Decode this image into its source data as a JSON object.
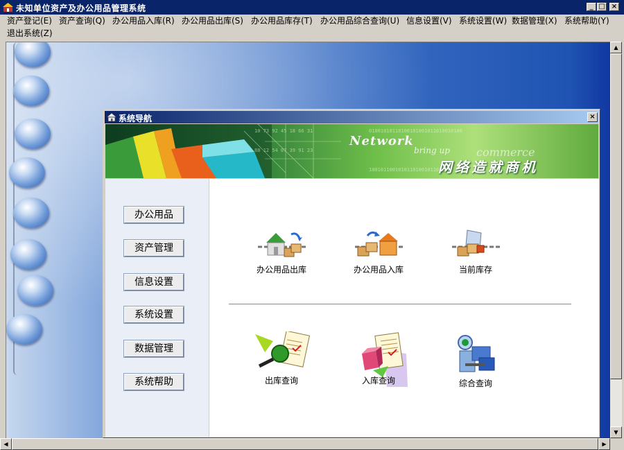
{
  "window": {
    "title": "未知单位资产及办公用品管理系统"
  },
  "menu": [
    "资产登记(E)",
    "资产查询(Q)",
    "办公用品入库(R)",
    "办公用品出库(S)",
    "办公用品库存(T)",
    "办公用品综合查询(U)",
    "信息设置(V)",
    "系统设置(W)",
    "数据管理(X)",
    "系统帮助(Y)",
    "退出系统(Z)"
  ],
  "nav": {
    "title": "系统导航",
    "banner": {
      "english": "Network",
      "english_sub": "bring up",
      "english_sub2": "commerce",
      "chinese": "网络造就商机"
    },
    "side_buttons": [
      "办公用品",
      "资产管理",
      "信息设置",
      "系统设置",
      "数据管理",
      "系统帮助"
    ],
    "functions_top": [
      "办公用品出库",
      "办公用品入库",
      "当前库存"
    ],
    "functions_bottom": [
      "出库查询",
      "入库查询",
      "综合查询"
    ]
  },
  "colors": {
    "titlebar": "#0a246a",
    "desktop": "#3b6fc4",
    "banner": "#2f7d3a"
  }
}
